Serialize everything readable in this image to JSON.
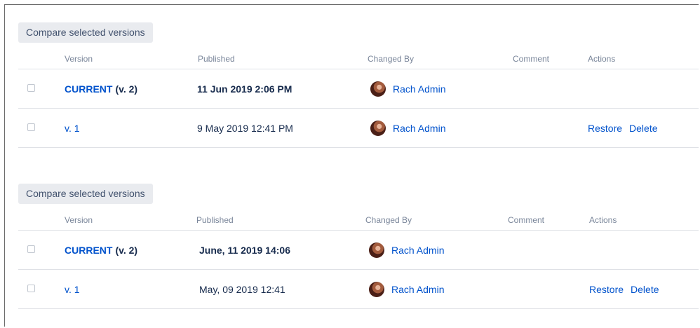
{
  "sections": [
    {
      "compare_label": "Compare selected versions",
      "headers": {
        "version": "Version",
        "published": "Published",
        "changed_by": "Changed By",
        "comment": "Comment",
        "actions": "Actions"
      },
      "rows": [
        {
          "version": "CURRENT",
          "version_note": "(v. 2)",
          "published": "11 Jun 2019 2:06 PM",
          "changed_by": "Rach Admin",
          "comment": "",
          "restore": "",
          "delete": ""
        },
        {
          "version": "v. 1",
          "version_note": "",
          "published": "9 May 2019 12:41 PM",
          "changed_by": "Rach Admin",
          "comment": "",
          "restore": "Restore",
          "delete": "Delete"
        }
      ]
    },
    {
      "compare_label": "Compare selected versions",
      "headers": {
        "version": "Version",
        "published": "Published",
        "changed_by": "Changed By",
        "comment": "Comment",
        "actions": "Actions"
      },
      "rows": [
        {
          "version": "CURRENT",
          "version_note": "(v. 2)",
          "published": "June, 11 2019 14:06",
          "changed_by": "Rach Admin",
          "comment": "",
          "restore": "",
          "delete": ""
        },
        {
          "version": "v. 1",
          "version_note": "",
          "published": "May, 09 2019 12:41",
          "changed_by": "Rach Admin",
          "comment": "",
          "restore": "Restore",
          "delete": "Delete"
        }
      ]
    }
  ],
  "colors": {
    "link": "#0052cc",
    "text": "#172b4d",
    "header": "#7a869a",
    "button_bg": "#e9ebef",
    "divider": "#dfe1e6"
  },
  "icons": {
    "avatar": "user-avatar-icon",
    "checkbox": "checkbox-icon"
  }
}
